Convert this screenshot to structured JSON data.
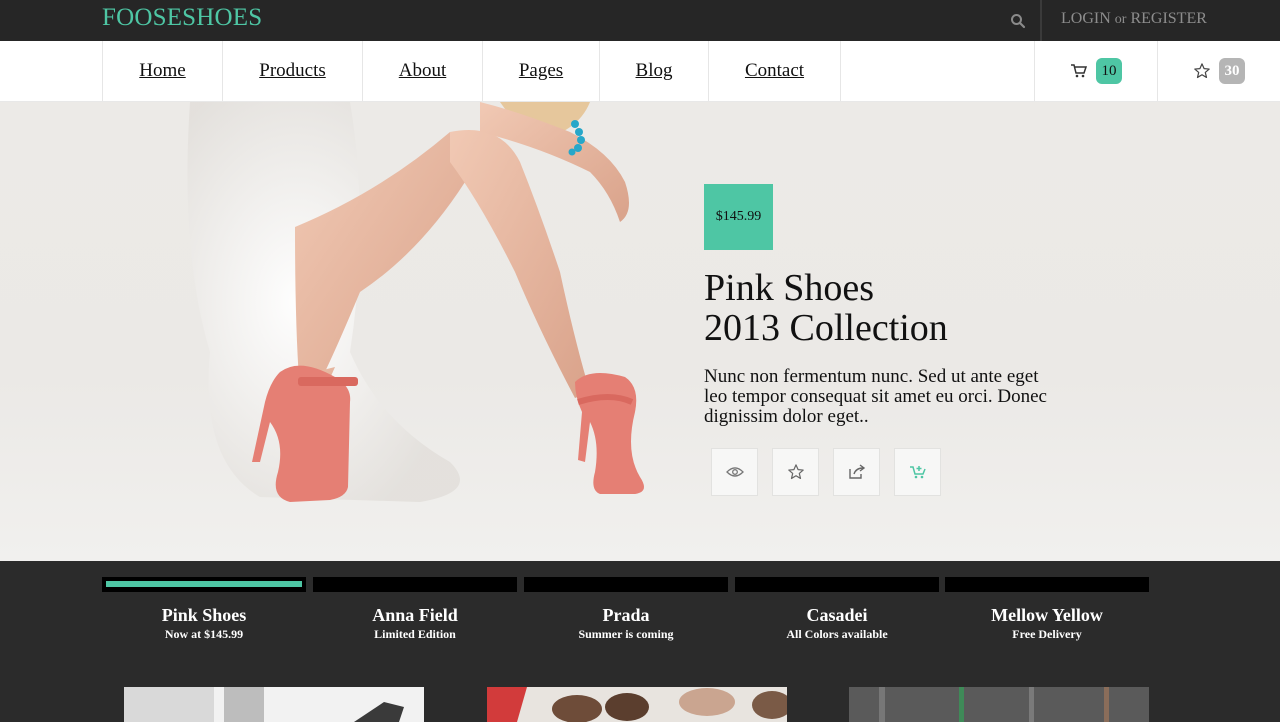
{
  "brand": {
    "logo": "FOOSESHOES",
    "accent": "#4ec6a4"
  },
  "topbar": {
    "login": "LOGIN",
    "or": "or",
    "register": "REGISTER"
  },
  "nav": {
    "items": [
      {
        "label": "Home"
      },
      {
        "label": "Products"
      },
      {
        "label": "About"
      },
      {
        "label": "Pages"
      },
      {
        "label": "Blog"
      },
      {
        "label": "Contact"
      }
    ],
    "cart_count": "10",
    "wishlist_count": "30"
  },
  "hero": {
    "price": "$145.99",
    "title_line1": "Pink Shoes",
    "title_line2": "2013 Collection",
    "description": "Nunc non fermentum nunc. Sed ut ante eget leo tempor consequat sit amet eu orci. Donec dignissim dolor eget..",
    "actions": [
      "eye-icon",
      "star-icon",
      "share-icon",
      "add-to-cart-icon"
    ]
  },
  "slides": [
    {
      "title": "Pink Shoes",
      "subtitle": "Now at $145.99",
      "active": true
    },
    {
      "title": "Anna Field",
      "subtitle": "Limited Edition",
      "active": false
    },
    {
      "title": "Prada",
      "subtitle": "Summer is coming",
      "active": false
    },
    {
      "title": "Casadei",
      "subtitle": "All Colors available",
      "active": false
    },
    {
      "title": "Mellow Yellow",
      "subtitle": "Free Delivery",
      "active": false
    }
  ]
}
